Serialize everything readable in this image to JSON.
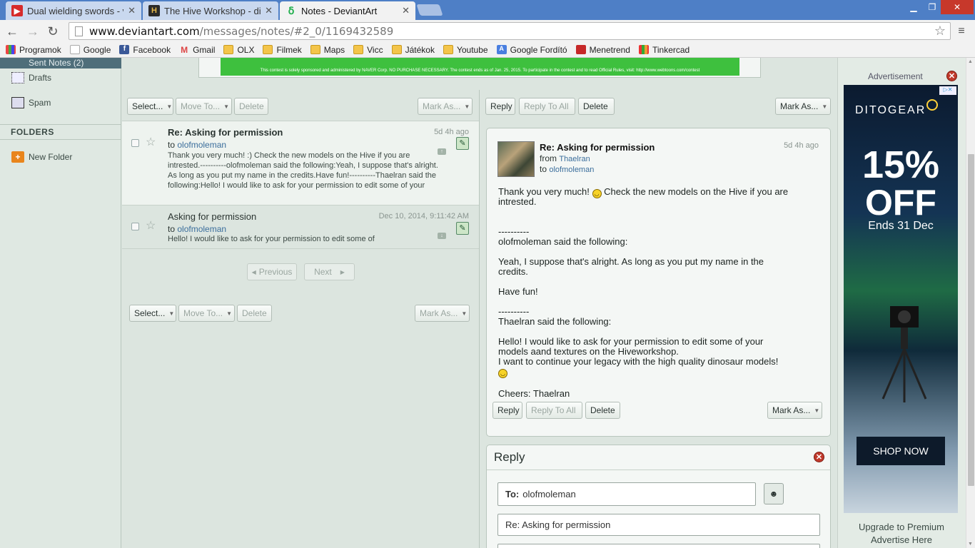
{
  "browser": {
    "tabs": [
      {
        "title": "Dual wielding swords - via",
        "icon": "youtube-icon",
        "active": false
      },
      {
        "title": "The Hive Workshop - dino",
        "icon": "hive-icon",
        "active": false
      },
      {
        "title": "Notes - DeviantArt",
        "icon": "deviantart-icon",
        "active": true
      }
    ],
    "url_host": "www.deviantart.com",
    "url_path": "/messages/notes/#2_0/1169432589",
    "bookmarks": [
      "Programok",
      "Google",
      "Facebook",
      "Gmail",
      "OLX",
      "Filmek",
      "Maps",
      "Vicc",
      "Játékok",
      "Youtube",
      "Google Fordító",
      "Menetrend",
      "Tinkercad"
    ]
  },
  "sidebar": {
    "sent_notes": "Sent Notes (2)",
    "drafts": "Drafts",
    "spam": "Spam",
    "folders_heading": "FOLDERS",
    "new_folder": "New Folder"
  },
  "banner": {
    "text": "This contest is solely sponsored and administered by NAVER Corp. NO PURCHASE NECESSARY. The contest ends as of Jan. 25, 2015. To participate in the contest and to read Official Rules, visit: http://www.webtoons.com/contest"
  },
  "list_toolbar": {
    "select": "Select...",
    "move_to": "Move To...",
    "delete": "Delete",
    "mark_as": "Mark As..."
  },
  "messages": [
    {
      "subject": "Re: Asking for permission",
      "date": "5d 4h ago",
      "to_label": "to",
      "to": "olofmoleman",
      "snippet": "Thank you very much! :) Check the new models on the Hive if you are intrested.----------olofmoleman said the following:Yeah, I suppose that's alright. As long as you put my name in the credits.Have fun!----------Thaelran said the following:Hello! I would like to ask for your permission to edit some of your"
    },
    {
      "subject": "Asking for permission",
      "date": "Dec 10, 2014, 9:11:42 AM",
      "to_label": "to",
      "to": "olofmoleman",
      "snippet": "Hello! I would like to ask for your permission to edit some of"
    }
  ],
  "pager": {
    "previous": "Previous",
    "next": "Next"
  },
  "viewer_toolbar": {
    "reply": "Reply",
    "reply_all": "Reply To All",
    "delete": "Delete",
    "mark_as": "Mark As..."
  },
  "viewer": {
    "subject": "Re: Asking for permission",
    "date": "5d 4h ago",
    "from_label": "from",
    "from": "Thaelran",
    "to_label": "to",
    "to": "olofmoleman",
    "body": {
      "l1": "Thank you very much!",
      "l1b": "Check the new models on the Hive if you are",
      "l2": "intrested.",
      "sep1": "----------",
      "l3": "olofmoleman said the following:",
      "l4": "Yeah, I suppose that's alright. As long as you put my name in the",
      "l5": "credits.",
      "l6": "Have fun!",
      "sep2": "----------",
      "l7": "Thaelran said the following:",
      "l8": "Hello! I would like to ask for your permission to edit some of your",
      "l9": "models aand textures on the Hiveworkshop.",
      "l10": "I want to continue your legacy with the high quality dinosaur models!",
      "l11": "Cheers: Thaelran"
    }
  },
  "reply": {
    "title": "Reply",
    "to_label": "To:",
    "to_value": "olofmoleman",
    "subject_value": "Re: Asking for permission"
  },
  "ad": {
    "label": "Advertisement",
    "brand": "DITOGEAR",
    "percent": "15%",
    "off": "OFF",
    "ends": "Ends 31 Dec",
    "cta": "SHOP NOW",
    "upgrade_line1": "Upgrade to Premium",
    "upgrade_line2": "Advertise Here"
  }
}
